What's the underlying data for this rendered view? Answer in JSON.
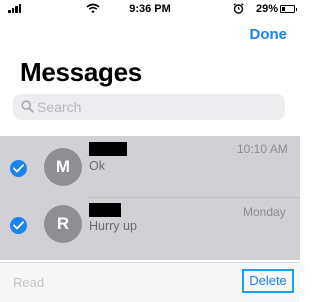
{
  "status_bar": {
    "time": "9:36 PM",
    "battery": "29%"
  },
  "header": {
    "done_label": "Done",
    "title": "Messages"
  },
  "search": {
    "placeholder": "Search"
  },
  "conversations": [
    {
      "avatar_initial": "M",
      "name": "",
      "time": "10:10 AM",
      "preview": "Ok",
      "selected": true
    },
    {
      "avatar_initial": "R",
      "name": "",
      "time": "Monday",
      "preview": "Hurry up",
      "selected": true
    }
  ],
  "toolbar": {
    "read_label": "Read",
    "delete_label": "Delete"
  },
  "colors": {
    "accent": "#1a83f0",
    "selection_bg": "#d1d1d5",
    "highlight_border": "#1aa0e8"
  }
}
